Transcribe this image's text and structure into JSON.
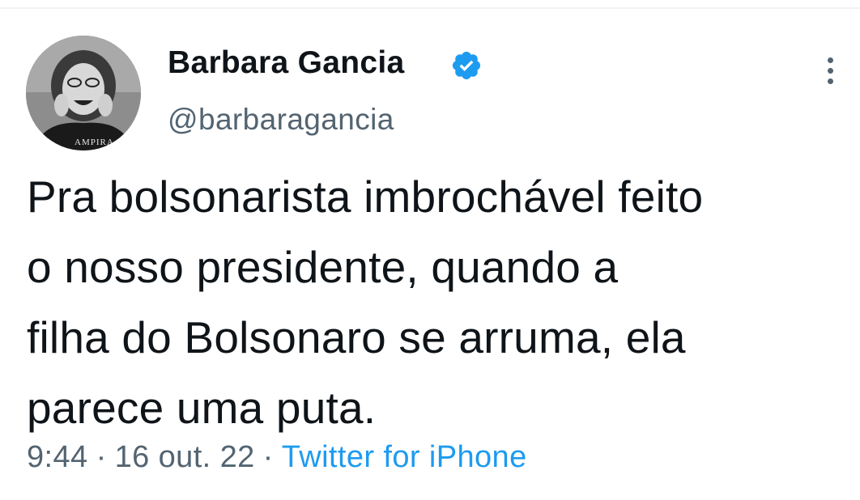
{
  "author": {
    "display_name": "Barbara Gancia",
    "handle": "@barbaragancia",
    "verified": true,
    "avatar_shirt_text": "AMPIRA"
  },
  "tweet": {
    "text_lines": [
      "Pra bolsonarista imbrochável feito",
      "o nosso presidente, quando a",
      "filha do Bolsonaro se arruma, ela",
      "parece uma puta."
    ],
    "time": "9:44",
    "separator": "·",
    "date": "16 out. 22",
    "source": "Twitter for iPhone"
  },
  "icons": {
    "verified": "verified-badge-icon",
    "more": "more-options-icon"
  },
  "colors": {
    "text_primary": "#0f1419",
    "text_secondary": "#536471",
    "accent": "#1d9bf0",
    "divider": "#eff3f4"
  }
}
